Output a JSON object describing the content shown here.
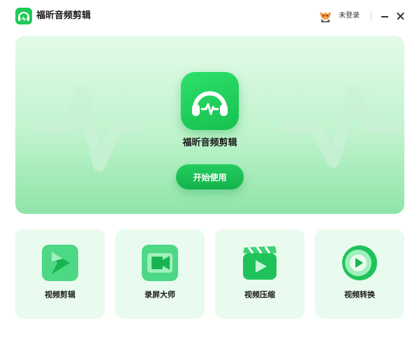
{
  "app": {
    "title": "福昕音频剪辑",
    "icon": "headphones-icon",
    "brand_color": "#1fca5a"
  },
  "header": {
    "login_status": "未登录"
  },
  "hero": {
    "title": "福昕音频剪辑",
    "start_label": "开始使用"
  },
  "tools": [
    {
      "label": "视频剪辑",
      "icon": "video-edit-icon"
    },
    {
      "label": "录屏大师",
      "icon": "screen-record-icon"
    },
    {
      "label": "视频压缩",
      "icon": "video-compress-icon"
    },
    {
      "label": "视频转换",
      "icon": "video-convert-icon"
    }
  ],
  "colors": {
    "accent": "#1fca5a",
    "card_bg": "#e9fbee",
    "hero_top": "#e4fbe8",
    "hero_bottom": "#8fe4a8"
  }
}
